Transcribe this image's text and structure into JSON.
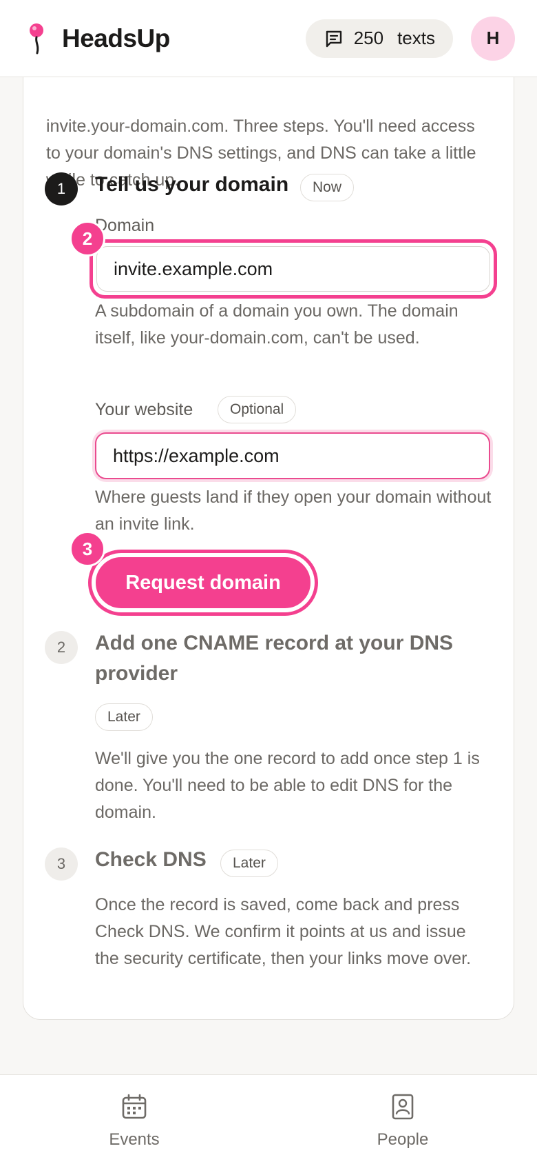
{
  "header": {
    "brand_name": "HeadsUp",
    "texts_count": "250",
    "texts_label": "texts",
    "avatar_initial": "H"
  },
  "intro": "invite.your-domain.com. Three steps. You'll need access to your domain's DNS settings, and DNS can take a little while to catch up.",
  "steps": [
    {
      "number": "1",
      "title": "Tell us your domain",
      "status": "Now",
      "domain_label": "Domain",
      "domain_value": "invite.example.com",
      "domain_help": "A subdomain of a domain you own. The domain itself, like your-domain.com, can't be used.",
      "website_label": "Your website",
      "website_badge": "Optional",
      "website_value": "https://example.com",
      "website_help": "Where guests land if they open your domain without an invite link.",
      "button_label": "Request domain"
    },
    {
      "number": "2",
      "title": "Add one CNAME record at your DNS provider",
      "status": "Later",
      "body": "We'll give you the one record to add once step 1 is done. You'll need to be able to edit DNS for the domain."
    },
    {
      "number": "3",
      "title": "Check DNS",
      "status": "Later",
      "body": "Once the record is saved, come back and press Check DNS. We confirm it points at us and issue the security certificate, then your links move over."
    }
  ],
  "markers": [
    "2",
    "3"
  ],
  "nav": {
    "events": "Events",
    "people": "People"
  },
  "colors": {
    "accent": "#f4408f",
    "text": "#1c1b1a",
    "muted": "#6b6864",
    "background": "#f8f7f5"
  }
}
